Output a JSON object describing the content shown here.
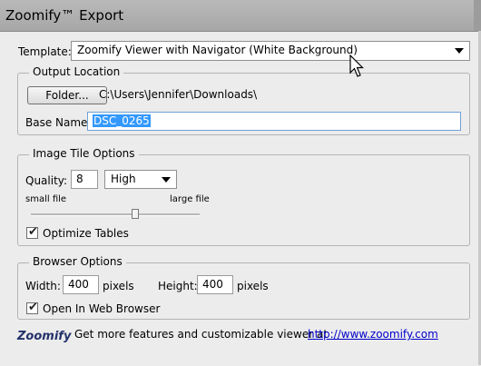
{
  "window": {
    "title": "Zoomify™ Export"
  },
  "template": {
    "label": "Template:",
    "value": "Zoomify Viewer with Navigator (White Background)"
  },
  "output_location": {
    "legend": "Output Location",
    "folder_button": "Folder...",
    "path": "C:\\Users\\Jennifer\\Downloads\\",
    "base_name_label": "Base Name:",
    "base_name_value": "DSC_0265"
  },
  "image_tile_options": {
    "legend": "Image Tile Options",
    "quality_label": "Quality:",
    "quality_value": "8",
    "quality_preset": "High",
    "small_file_label": "small file",
    "large_file_label": "large file",
    "slider_level": 0.62,
    "optimize_tables_label": "Optimize Tables",
    "optimize_tables_checked": true
  },
  "browser_options": {
    "legend": "Browser Options",
    "width_label": "Width:",
    "width_value": "400",
    "width_unit": "pixels",
    "height_label": "Height:",
    "height_value": "400",
    "height_unit": "pixels",
    "open_browser_label": "Open In Web Browser",
    "open_browser_checked": true
  },
  "footer": {
    "logo": "Zoomify",
    "promo_text": "Get more features and customizable viewer at",
    "link_text": "http://www.zoomify.com"
  }
}
